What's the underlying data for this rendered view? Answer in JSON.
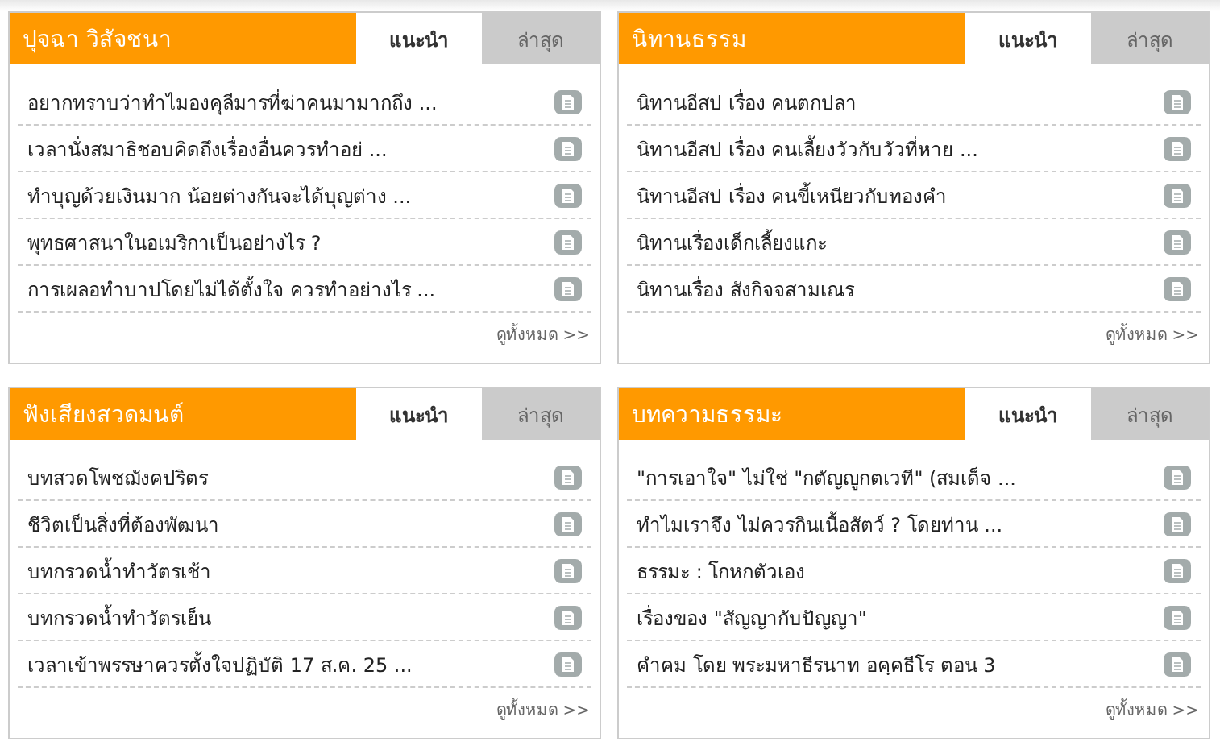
{
  "panels": [
    {
      "title": "ปุจฉา วิสัจชนา",
      "tabs": [
        {
          "label": "แนะนำ",
          "selected": true
        },
        {
          "label": "ล่าสุด",
          "selected": false
        }
      ],
      "items": [
        "อยากทราบว่าทำไมองคุลีมารที่ฆ่าคนมามากถึง ...",
        "เวลานั่งสมาธิชอบคิดถึงเรื่องอื่นควรทำอย่ ...",
        "ทำบุญด้วยเงินมาก น้อยต่างกันจะได้บุญต่าง ...",
        "พุทธศาสนาในอเมริกาเป็นอย่างไร ?",
        "การเผลอทำบาปโดยไม่ได้ตั้งใจ ควรทำอย่างไร ..."
      ],
      "more": "ดูทั้งหมด >>"
    },
    {
      "title": "นิทานธรรม",
      "tabs": [
        {
          "label": "แนะนำ",
          "selected": true
        },
        {
          "label": "ล่าสุด",
          "selected": false
        }
      ],
      "items": [
        "นิทานอีสป เรื่อง คนตกปลา",
        "นิทานอีสป เรื่อง คนเลี้ยงวัวกับวัวที่หาย ...",
        "นิทานอีสป เรื่อง คนขี้เหนียวกับทองคำ",
        "นิทานเรื่องเด็กเลี้ยงแกะ",
        "นิทานเรื่อง สังกิจจสามเณร"
      ],
      "more": "ดูทั้งหมด >>"
    },
    {
      "title": "ฟังเสียงสวดมนต์",
      "tabs": [
        {
          "label": "แนะนำ",
          "selected": true
        },
        {
          "label": "ล่าสุด",
          "selected": false
        }
      ],
      "items": [
        "บทสวดโพชฌังคปริตร",
        "ชีวิตเป็นสิ่งที่ต้องพัฒนา",
        "บทกรวดน้ำทำวัตรเช้า",
        "บทกรวดน้ำทำวัตรเย็น",
        "เวลาเข้าพรรษาควรตั้งใจปฏิบัติ 17 ส.ค. 25 ..."
      ],
      "more": "ดูทั้งหมด >>"
    },
    {
      "title": "บทความธรรมะ",
      "tabs": [
        {
          "label": "แนะนำ",
          "selected": true
        },
        {
          "label": "ล่าสุด",
          "selected": false
        }
      ],
      "items": [
        "\"การเอาใจ\" ไม่ใช่ \"กตัญญูกตเวที\" (สมเด็จ ...",
        "ทำไมเราจึง ไม่ควรกินเนื้อสัตว์ ? โดยท่าน ...",
        "ธรรมะ : โกหกตัวเอง",
        "เรื่องของ \"สัญญากับปัญญา\"",
        "คำคม โดย พระมหาธีรนาท อคฺคธีโร ตอน 3"
      ],
      "more": "ดูทั้งหมด >>"
    }
  ]
}
